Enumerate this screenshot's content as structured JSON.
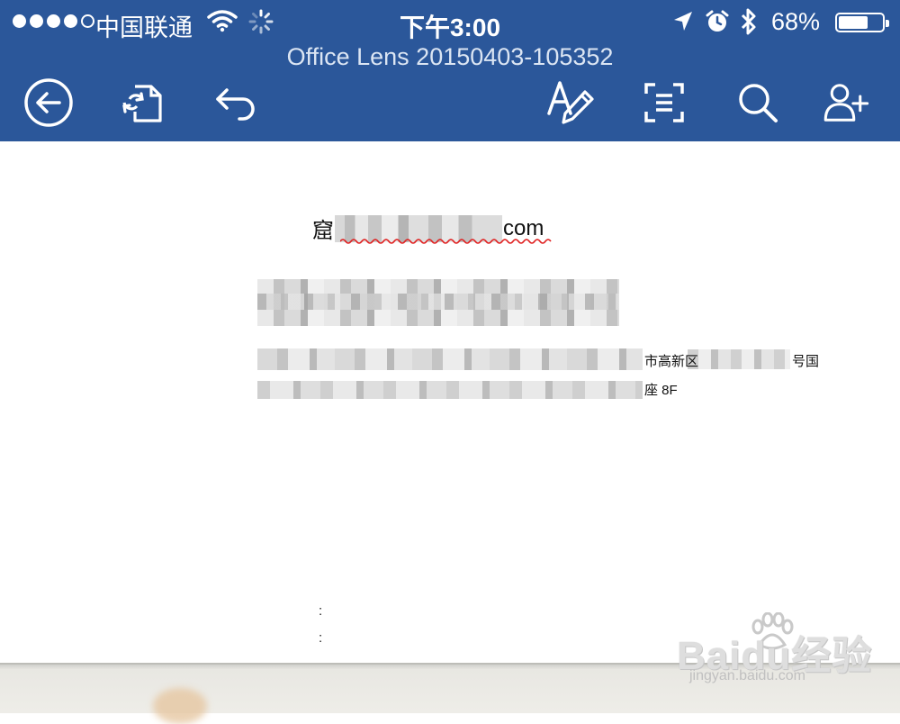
{
  "status_bar": {
    "carrier": "中国联通",
    "time": "下午3:00",
    "battery_percent": "68%",
    "battery_level": 0.68,
    "icons": [
      "signal-dots",
      "wifi-icon",
      "activity-spinner-icon",
      "location-arrow-icon",
      "alarm-icon",
      "bluetooth-icon",
      "battery-icon"
    ]
  },
  "header": {
    "title": "Office Lens 20150403-105352"
  },
  "toolbar": {
    "buttons": [
      {
        "name": "back-button",
        "icon": "back-arrow-circle-icon"
      },
      {
        "name": "convert-button",
        "icon": "refresh-document-icon"
      },
      {
        "name": "undo-button",
        "icon": "undo-icon"
      },
      {
        "name": "edit-text-button",
        "icon": "text-edit-pen-icon"
      },
      {
        "name": "scan-button",
        "icon": "scan-text-icon"
      },
      {
        "name": "search-button",
        "icon": "search-icon"
      },
      {
        "name": "share-button",
        "icon": "add-person-icon"
      }
    ]
  },
  "document": {
    "email_prefix": "窟",
    "email_suffix": "com",
    "address_line1_mid": "市高新区",
    "address_line1_end": "号国",
    "address_line2": "座 8F",
    "colon_1": ":",
    "colon_2": ":"
  },
  "watermark": {
    "brand": "Baidu经验",
    "url": "jingyan.baidu.com"
  },
  "colors": {
    "header_bg": "#2b579a",
    "page_bg": "#ffffff"
  }
}
